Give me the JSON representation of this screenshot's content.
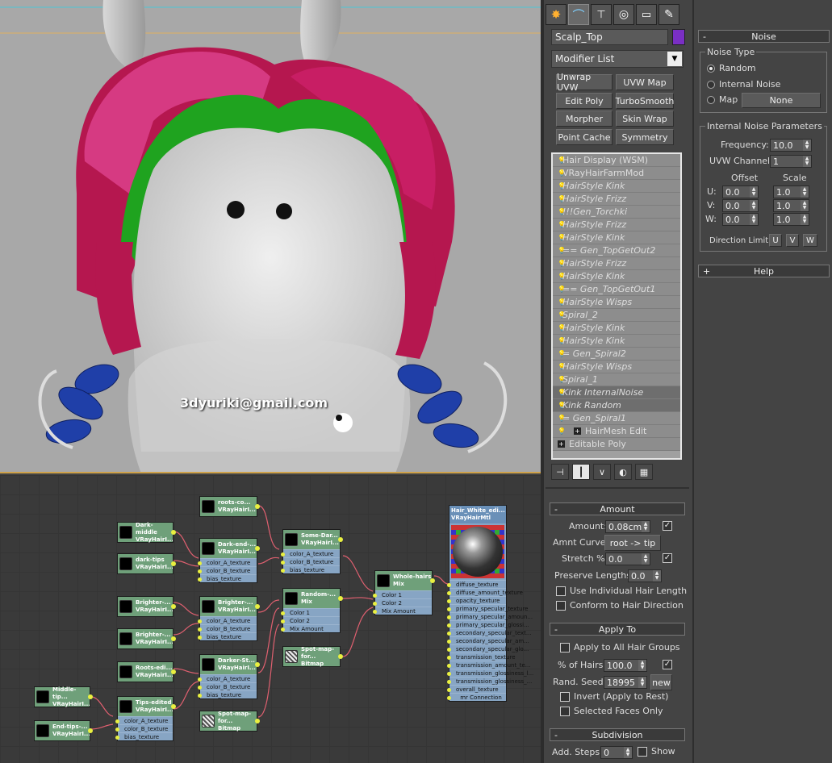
{
  "viewport": {
    "watermark": "3dyuriki@gmail.com"
  },
  "colors": {
    "object_color": "#7a2fc4",
    "hair_magenta": "#c2185b",
    "hair_green": "#1fa31f",
    "braid_blue": "#1f3fa8",
    "node_green": "#6fa07a",
    "node_blue": "#87a5c4",
    "wire_color": "#e06070"
  },
  "command_panel": {
    "tabs": [
      "create-icon",
      "modify-icon",
      "hierarchy-icon",
      "motion-icon",
      "display-icon",
      "utilities-icon"
    ],
    "object_name": "Scalp_Top",
    "modifier_list": "Modifier List",
    "modifier_buttons": [
      "Unwrap UVW",
      "UVW Map",
      "Edit Poly",
      "TurboSmooth",
      "Morpher",
      "Skin Wrap",
      "Point Cache",
      "Symmetry"
    ],
    "stack": [
      {
        "label": "Hair Display (WSM)",
        "italic": false
      },
      {
        "label": "VRayHairFarmMod",
        "italic": false
      },
      {
        "label": "HairStyle Kink",
        "italic": true
      },
      {
        "label": "HairStyle Frizz",
        "italic": true
      },
      {
        "label": "!!!Gen_Torchki",
        "italic": true
      },
      {
        "label": "HairStyle Frizz",
        "italic": true
      },
      {
        "label": "HairStyle Kink",
        "italic": true
      },
      {
        "label": "== Gen_TopGetOut2",
        "italic": true
      },
      {
        "label": "HairStyle Frizz",
        "italic": true
      },
      {
        "label": "HairStyle Kink",
        "italic": true
      },
      {
        "label": "== Gen_TopGetOut1",
        "italic": true
      },
      {
        "label": "HairStyle Wisps",
        "italic": true
      },
      {
        "label": "Spiral_2",
        "italic": true
      },
      {
        "label": "HairStyle Kink",
        "italic": true
      },
      {
        "label": "HairStyle Kink",
        "italic": true
      },
      {
        "label": "= Gen_Spiral2",
        "italic": true
      },
      {
        "label": "HairStyle Wisps",
        "italic": true
      },
      {
        "label": "Spiral_1",
        "italic": true
      },
      {
        "label": "Kink InternalNoise",
        "italic": true
      },
      {
        "label": "Kink Random",
        "italic": true
      },
      {
        "label": "= Gen_Spiral1",
        "italic": true
      },
      {
        "label": "HairMesh Edit",
        "italic": false
      },
      {
        "label": "Editable Poly",
        "italic": false
      }
    ],
    "amount": {
      "title": "Amount",
      "amount_label": "Amount:",
      "amount_value": "0.08cm",
      "curve_label": "Amnt Curve:",
      "curve_value": "root -> tip",
      "stretch_label": "Stretch %",
      "stretch_value": "0.0",
      "preserve_label": "Preserve Lengths:",
      "preserve_value": "0.0",
      "use_individual": "Use Individual Hair Length",
      "conform": "Conform to Hair Direction"
    },
    "apply_to": {
      "title": "Apply To",
      "all_groups": "Apply to All Hair Groups",
      "percent_label": "% of Hairs:",
      "percent_value": "100.0",
      "seed_label": "Rand. Seed:",
      "seed_value": "18995",
      "new_label": "new",
      "invert": "Invert (Apply to Rest)",
      "selected_faces": "Selected Faces Only"
    },
    "subdivision": {
      "title": "Subdivision",
      "steps_label": "Add. Steps:",
      "steps_value": "0",
      "show_label": "Show"
    }
  },
  "noise_panel": {
    "title": "Noise",
    "noise_type_group": "Noise Type",
    "random": "Random",
    "internal_noise": "Internal Noise",
    "map": "Map",
    "map_button": "None",
    "internal_params_group": "Internal Noise Parameters",
    "frequency_label": "Frequency:",
    "frequency_value": "10.0",
    "uvw_channel_label": "UVW Channel:",
    "uvw_channel_value": "1",
    "offset_label": "Offset",
    "scale_label": "Scale",
    "u_label": "U:",
    "v_label": "V:",
    "w_label": "W:",
    "u_offset": "0.0",
    "v_offset": "0.0",
    "w_offset": "0.0",
    "u_scale": "1.0",
    "v_scale": "1.0",
    "w_scale": "1.0",
    "direction_limit_label": "Direction Limit:",
    "dir_u": "U",
    "dir_v": "V",
    "dir_w": "W",
    "help_title": "Help"
  },
  "slate": {
    "nodes": [
      {
        "id": "roots-co",
        "title": "roots-co...",
        "type": "VRayHairI...",
        "slots": []
      },
      {
        "id": "dark-middle",
        "title": "Dark-middle",
        "type": "VRayHairI...",
        "slots": []
      },
      {
        "id": "dark-end",
        "title": "Dark-end-...",
        "type": "VRayHairI...",
        "slots": [
          "color_A_texture",
          "color_B_texture",
          "bias_texture"
        ]
      },
      {
        "id": "some-dar",
        "title": "Some-Dar...",
        "type": "VRayHairI...",
        "slots": [
          "color_A_texture",
          "color_B_texture",
          "bias_texture"
        ]
      },
      {
        "id": "dark-tips",
        "title": "dark-tips",
        "type": "VRayHairI...",
        "slots": []
      },
      {
        "id": "whole-hairs",
        "title": "Whole-hairs",
        "type": "Mix",
        "slots": [
          "Color 1",
          "Color 2",
          "Mix Amount"
        ]
      },
      {
        "id": "random",
        "title": "Random-...",
        "type": "Mix",
        "slots": [
          "Color 1",
          "Color 2",
          "Mix Amount"
        ]
      },
      {
        "id": "brighter1",
        "title": "Brighter-...",
        "type": "VRayHairI...",
        "slots": []
      },
      {
        "id": "brighter2",
        "title": "Brighter-...",
        "type": "VRayHairI...",
        "slots": [
          "color_A_texture",
          "color_B_texture",
          "bias_texture"
        ]
      },
      {
        "id": "brighter3",
        "title": "Brighter-...",
        "type": "VRayHairI...",
        "slots": []
      },
      {
        "id": "spot-map1",
        "title": "Spot-map-for...",
        "type": "Bitmap",
        "slots": []
      },
      {
        "id": "roots-edi",
        "title": "Roots-edi...",
        "type": "VRayHairI...",
        "slots": []
      },
      {
        "id": "darker-st",
        "title": "Darker-St...",
        "type": "VRayHairI...",
        "slots": [
          "color_A_texture",
          "color_B_texture",
          "bias_texture"
        ]
      },
      {
        "id": "middle-tip",
        "title": "Middle-tip...",
        "type": "VRayHairI...",
        "slots": []
      },
      {
        "id": "tips-edited",
        "title": "Tips-edited",
        "type": "VRayHairI...",
        "slots": [
          "color_A_texture",
          "color_B_texture",
          "bias_texture"
        ]
      },
      {
        "id": "end-tips",
        "title": "End-tips-...",
        "type": "VRayHairI...",
        "slots": []
      },
      {
        "id": "spot-map2",
        "title": "Spot-map-for...",
        "type": "Bitmap",
        "slots": []
      }
    ],
    "material": {
      "title": "Hair_White_edi...",
      "type": "VRayHairMtl",
      "slots": [
        "diffuse_texture",
        "diffuse_amount_texture",
        "opacity_texture",
        "primary_specular_texture",
        "primary_specular_amoun...",
        "primary_specular_glossi...",
        "secondary_specular_text...",
        "secondary_specular_am...",
        "secondary_specular_glo...",
        "transmission_texture",
        "transmission_amount_te...",
        "transmission_glossiness_l...",
        "transmission_glossiness_...",
        "overall_texture"
      ],
      "footer": "mr Connection"
    }
  }
}
